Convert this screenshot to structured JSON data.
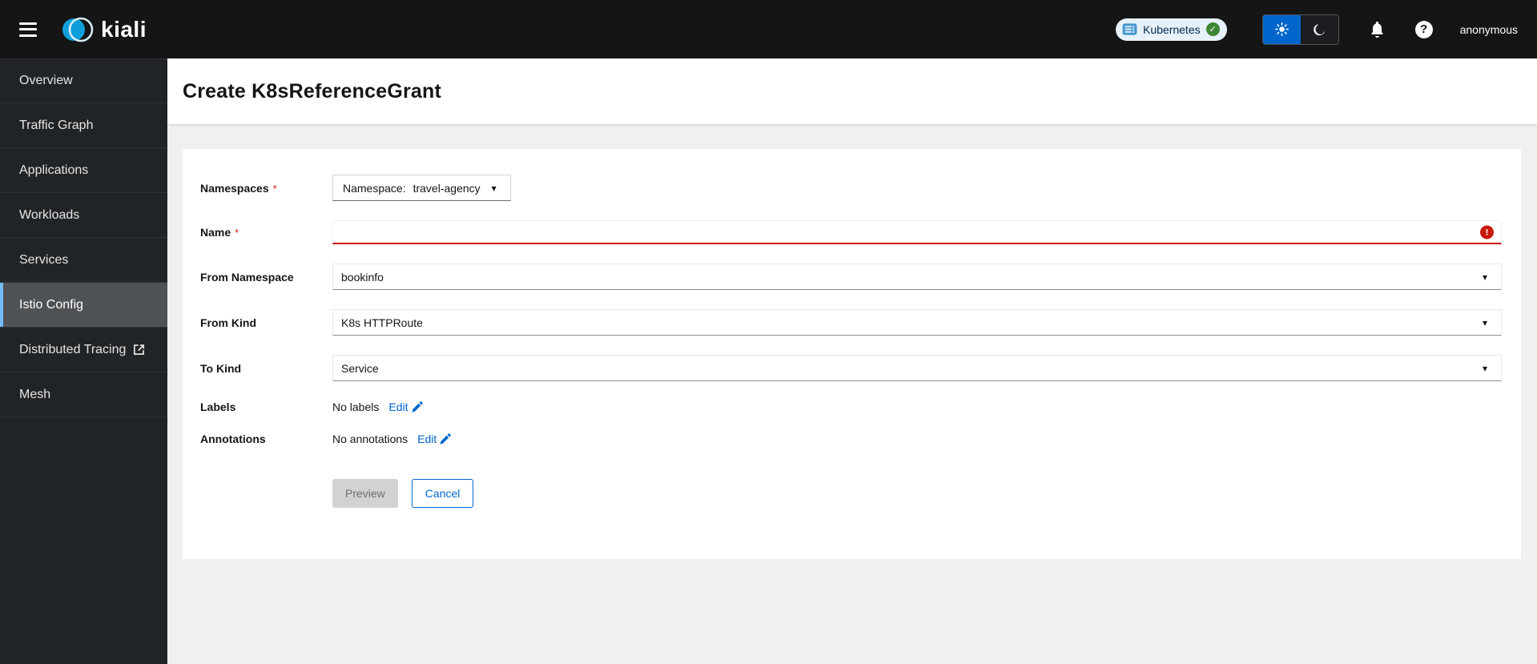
{
  "masthead": {
    "brand": "kiali",
    "cluster_badge": {
      "label": "Kubernetes",
      "status": "healthy"
    },
    "user": "anonymous"
  },
  "sidebar": {
    "items": [
      {
        "label": "Overview",
        "active": false
      },
      {
        "label": "Traffic Graph",
        "active": false
      },
      {
        "label": "Applications",
        "active": false
      },
      {
        "label": "Workloads",
        "active": false
      },
      {
        "label": "Services",
        "active": false
      },
      {
        "label": "Istio Config",
        "active": true
      },
      {
        "label": "Distributed Tracing",
        "active": false,
        "external": true
      },
      {
        "label": "Mesh",
        "active": false
      }
    ]
  },
  "page": {
    "title": "Create K8sReferenceGrant"
  },
  "form": {
    "required_marker": "*",
    "namespaces": {
      "label": "Namespaces",
      "required": true,
      "dropdown_prefix": "Namespace:",
      "value": "travel-agency"
    },
    "name": {
      "label": "Name",
      "required": true,
      "value": "",
      "invalid": true
    },
    "from_namespace": {
      "label": "From Namespace",
      "value": "bookinfo"
    },
    "from_kind": {
      "label": "From Kind",
      "value": "K8s HTTPRoute"
    },
    "to_kind": {
      "label": "To Kind",
      "value": "Service"
    },
    "labels": {
      "label": "Labels",
      "value": "No labels",
      "edit_label": "Edit"
    },
    "annotations": {
      "label": "Annotations",
      "value": "No annotations",
      "edit_label": "Edit"
    },
    "buttons": {
      "preview": "Preview",
      "cancel": "Cancel"
    }
  },
  "icons": {
    "menu": "hamburger-icon",
    "brand": "kiali-logo",
    "cluster": "kubernetes-icon",
    "cluster_status": "check-circle-icon",
    "theme_light": "sun-icon",
    "theme_dark": "moon-icon",
    "notifications": "bell-icon",
    "help": "question-circle-icon",
    "external_link": "external-link-icon",
    "dropdown": "caret-down-icon",
    "error": "exclamation-circle-icon",
    "edit": "pencil-icon"
  },
  "colors": {
    "primary": "#0066cc",
    "danger": "#c9190b",
    "success": "#3e8635",
    "nav_active_border": "#73bcf7",
    "masthead_bg": "#151515",
    "sidebar_bg": "#212427",
    "content_bg": "#f0f0f0"
  }
}
